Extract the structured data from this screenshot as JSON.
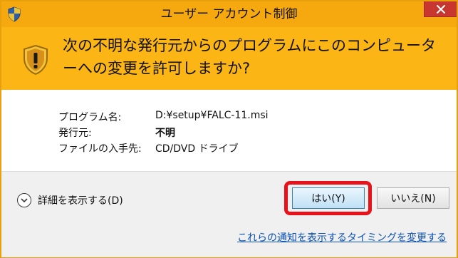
{
  "window": {
    "title": "ユーザー アカウント制御"
  },
  "banner": {
    "question": "次の不明な発行元からのプログラムにこのコンピューターへの変更を許可しますか?"
  },
  "details": {
    "program_label": "プログラム名:",
    "program_value": "D:¥setup¥FALC-11.msi",
    "publisher_label": "発行元:",
    "publisher_value": "不明",
    "source_label": "ファイルの入手先:",
    "source_value": "CD/DVD ドライブ"
  },
  "footer": {
    "show_details_label": "詳細を表示する(D)",
    "yes_label": "はい(Y)",
    "no_label": "いいえ(N)",
    "notification_link": "これらの通知を表示するタイミングを変更する"
  },
  "colors": {
    "titlebar": "#f6a90f",
    "banner": "#fbb514",
    "close": "#c7372f",
    "highlight": "#e8131a",
    "link": "#0a4fb4"
  }
}
